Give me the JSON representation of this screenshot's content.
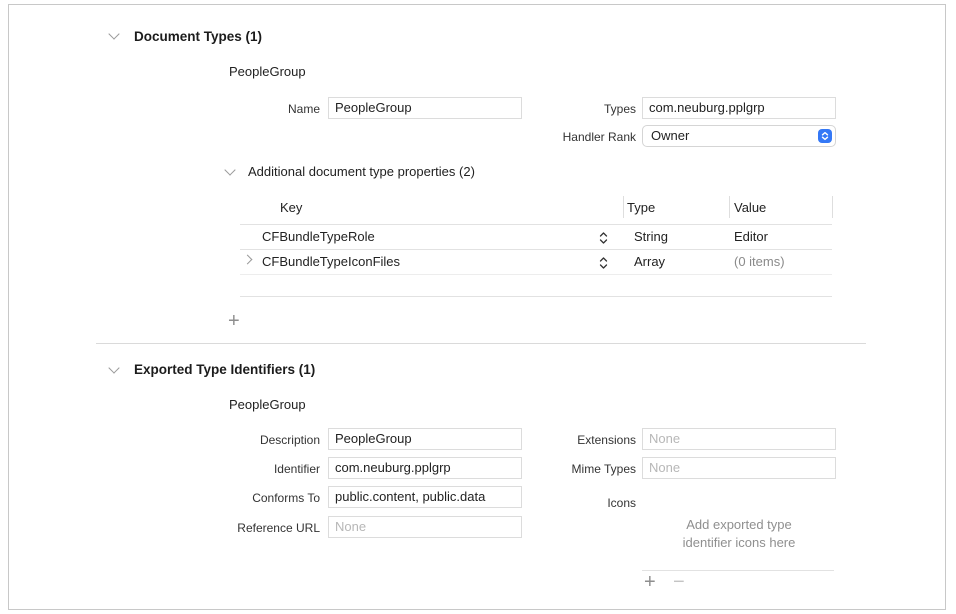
{
  "document_types": {
    "heading": "Document Types (1)",
    "item_title": "PeopleGroup",
    "name_label": "Name",
    "name_value": "PeopleGroup",
    "types_label": "Types",
    "types_value": "com.neuburg.pplgrp",
    "handler_rank_label": "Handler Rank",
    "handler_rank_value": "Owner",
    "additional": {
      "heading": "Additional document type properties (2)",
      "columns": {
        "key": "Key",
        "type": "Type",
        "value": "Value"
      },
      "rows": [
        {
          "key": "CFBundleTypeRole",
          "type": "String",
          "value": "Editor"
        },
        {
          "key": "CFBundleTypeIconFiles",
          "type": "Array",
          "value": "(0 items)"
        }
      ]
    },
    "add_symbol": "+"
  },
  "exported_types": {
    "heading": "Exported Type Identifiers (1)",
    "item_title": "PeopleGroup",
    "description_label": "Description",
    "description_value": "PeopleGroup",
    "identifier_label": "Identifier",
    "identifier_value": "com.neuburg.pplgrp",
    "conforms_label": "Conforms To",
    "conforms_value": "public.content, public.data",
    "reference_url_label": "Reference URL",
    "reference_url_placeholder": "None",
    "extensions_label": "Extensions",
    "extensions_placeholder": "None",
    "mime_types_label": "Mime Types",
    "mime_types_placeholder": "None",
    "icons_label": "Icons",
    "icons_hint_line1": "Add exported type",
    "icons_hint_line2": "identifier icons here",
    "add_symbol": "+",
    "remove_symbol": "−"
  },
  "colors": {
    "accent": "#3478f6",
    "divider": "#e2e2e2",
    "placeholder": "#b7b7b7"
  }
}
